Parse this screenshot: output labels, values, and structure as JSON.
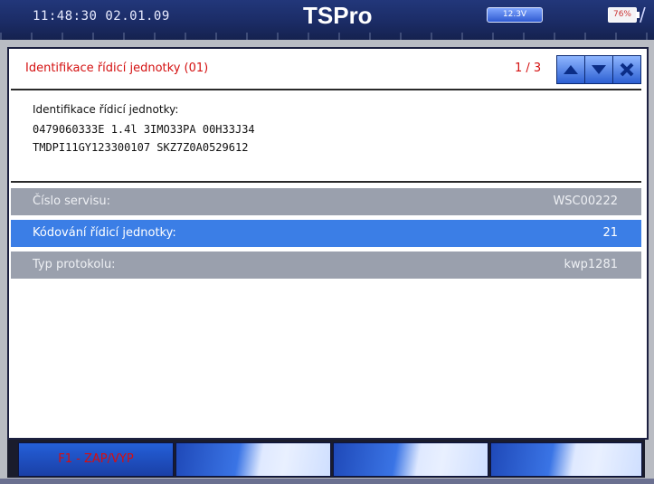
{
  "status_bar": {
    "time": "11:48:30  02.01.09",
    "app_title": "TSPro",
    "connection": "12.3V",
    "battery": "76%"
  },
  "panel": {
    "title": "Identifikace řídicí jednotky (01)",
    "pager": "1 / 3",
    "nav": {
      "up_icon": "arrow-up-icon",
      "down_icon": "arrow-down-icon",
      "close_icon": "close-icon"
    }
  },
  "info": {
    "line1": "Identifikace řídicí jednotky:",
    "line2": "0479060333E 1.4l 3IMO33PA 00H33J34",
    "line3": "TMDPI11GY123300107 SKZ7Z0A0529612"
  },
  "rows": [
    {
      "label": "Číslo servisu:",
      "value": "WSC00222",
      "state": "grey"
    },
    {
      "label": "Kódování řídicí jednotky:",
      "value": "21",
      "state": "selected"
    },
    {
      "label": "Typ protokolu:",
      "value": "kwp1281",
      "state": "grey"
    }
  ],
  "function_keys": [
    {
      "label": "F1 - ZAP/VYP"
    },
    {
      "label": ""
    },
    {
      "label": ""
    },
    {
      "label": ""
    }
  ],
  "colors": {
    "accent_red": "#d41010",
    "selection_blue": "#3b7ee6",
    "row_grey": "#9aa0ad",
    "header_navy": "#1b2c66"
  }
}
